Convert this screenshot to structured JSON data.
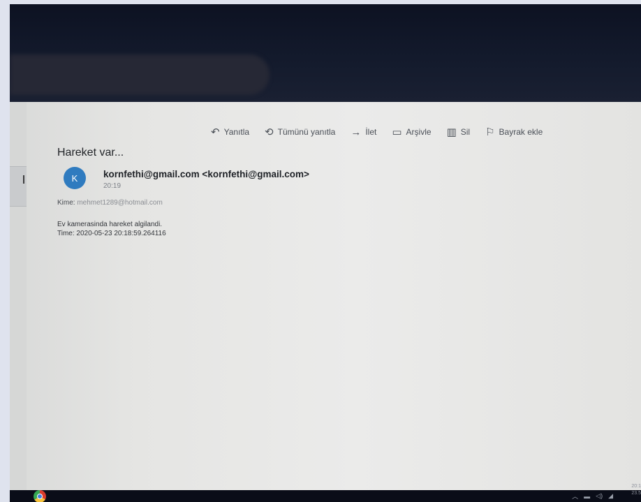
{
  "toolbar": {
    "reply": {
      "label": "Yanıtla",
      "icon": "reply-icon"
    },
    "reply_all": {
      "label": "Tümünü yanıtla",
      "icon": "reply-all-icon"
    },
    "forward": {
      "label": "İlet",
      "icon": "forward-icon"
    },
    "archive": {
      "label": "Arşivle",
      "icon": "archive-icon"
    },
    "delete": {
      "label": "Sil",
      "icon": "trash-icon"
    },
    "flag": {
      "label": "Bayrak ekle",
      "icon": "flag-icon"
    }
  },
  "message": {
    "subject": "Hareket var...",
    "avatar_initial": "K",
    "sender": "kornfethi@gmail.com <kornfethi@gmail.com>",
    "time": "20:19",
    "to_label": "Kime:",
    "to_address": "mehmet1289@hotmail.com",
    "body_line1": "Ev kamerasinda hareket algilandi.",
    "body_line2": "Time: 2020-05-23 20:18:59.264116"
  },
  "colors": {
    "avatar": "#2f7bbf",
    "window_background": "#e6e6e4",
    "taskbar": "#0a0d18"
  },
  "taskbar": {
    "clock_time": "20:1",
    "clock_date": "23.5"
  }
}
